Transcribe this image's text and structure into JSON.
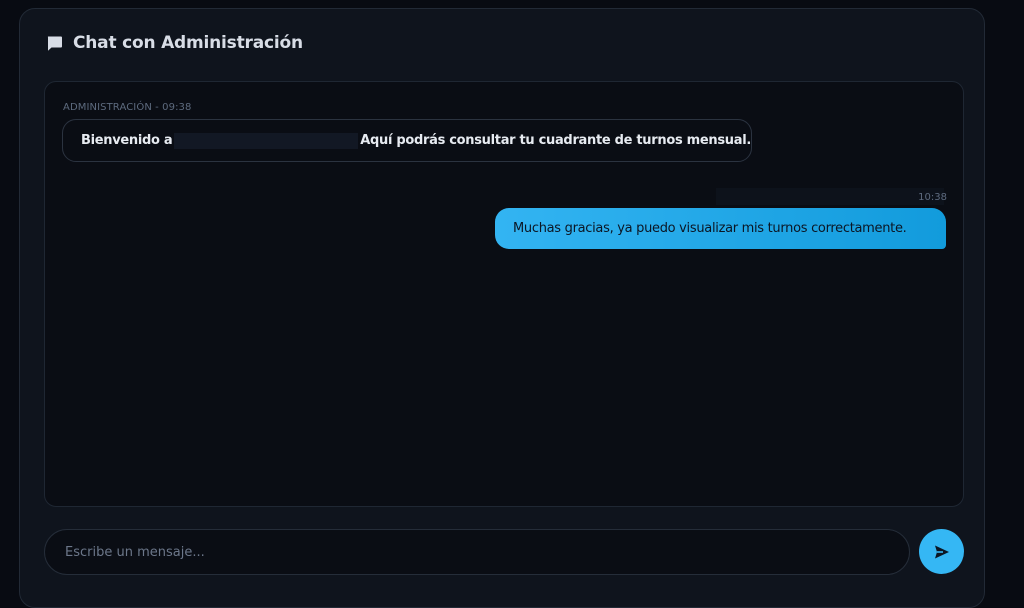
{
  "chat": {
    "title": "Chat con Administración",
    "header_icon": "chat-bubble-icon",
    "messages": [
      {
        "direction": "incoming",
        "meta": "ADMINISTRACIÓN - 09:38",
        "text_before": "Bienvenido a",
        "text_after": "Aquí podrás consultar tu cuadrante de turnos mensual."
      },
      {
        "direction": "outgoing",
        "meta": "10:38",
        "text": "Muchas gracias, ya puedo visualizar mis turnos correctamente."
      }
    ]
  },
  "composer": {
    "placeholder": "Escribe un mensaje...",
    "send_icon": "send-icon"
  },
  "colors": {
    "background": "#080b12",
    "card": "#0f141d",
    "accent": "#35b7f4",
    "text": "#e7ebf1",
    "muted": "#5d6a7e"
  }
}
